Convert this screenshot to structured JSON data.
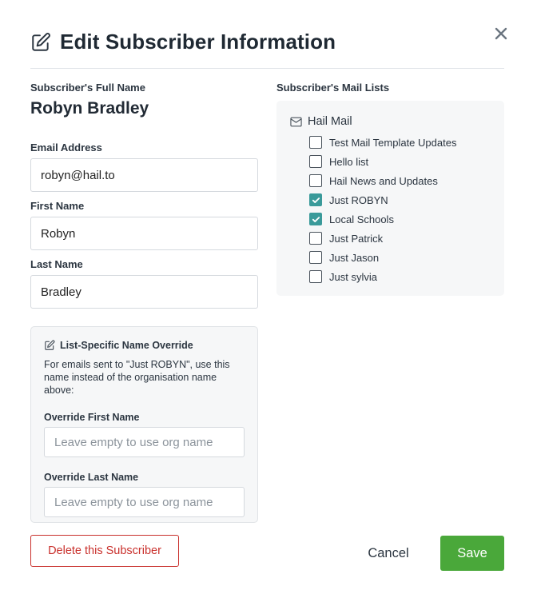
{
  "dialog": {
    "title": "Edit Subscriber Information"
  },
  "subscriber": {
    "full_name_label": "Subscriber's Full Name",
    "full_name": "Robyn Bradley",
    "email_label": "Email Address",
    "email_value": "robyn@hail.to",
    "first_name_label": "First Name",
    "first_name_value": "Robyn",
    "last_name_label": "Last Name",
    "last_name_value": "Bradley"
  },
  "override": {
    "title": "List-Specific Name Override",
    "description": "For emails sent to \"Just ROBYN\", use this name instead of the organisation name above:",
    "first_label": "Override First Name",
    "first_placeholder": "Leave empty to use org name",
    "last_label": "Override Last Name",
    "last_placeholder": "Leave empty to use org name"
  },
  "mail_lists": {
    "label": "Subscriber's Mail Lists",
    "group_name": "Hail Mail",
    "items": [
      {
        "name": "Test Mail Template Updates",
        "checked": false
      },
      {
        "name": "Hello list",
        "checked": false
      },
      {
        "name": "Hail News and Updates",
        "checked": false
      },
      {
        "name": "Just ROBYN",
        "checked": true
      },
      {
        "name": "Local Schools",
        "checked": true
      },
      {
        "name": "Just Patrick",
        "checked": false
      },
      {
        "name": "Just Jason",
        "checked": false
      },
      {
        "name": "Just sylvia",
        "checked": false
      }
    ]
  },
  "buttons": {
    "delete_label": "Delete this Subscriber",
    "cancel_label": "Cancel",
    "save_label": "Save"
  },
  "colors": {
    "check_accent": "#3a9a9a",
    "save_green": "#4aa83a",
    "delete_red": "#c9302c"
  }
}
